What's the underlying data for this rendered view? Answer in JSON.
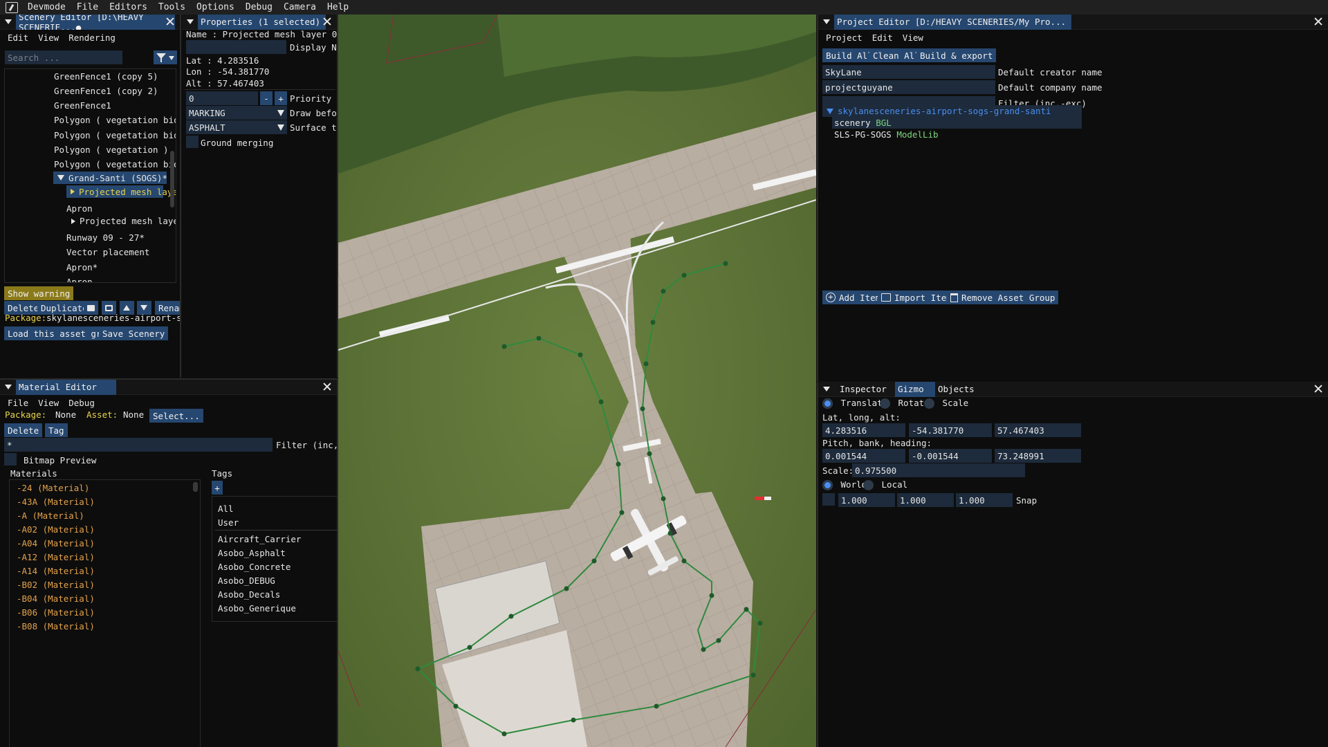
{
  "menubar": [
    "Devmode",
    "File",
    "Editors",
    "Tools",
    "Options",
    "Debug",
    "Camera",
    "Help"
  ],
  "scenery_editor": {
    "title": "Scenery Editor [D:\\HEAVY SCENERIE...●",
    "menu": [
      "Edit",
      "View",
      "Rendering"
    ],
    "search_placeholder": "Search ...",
    "tree": [
      "GreenFence1 (copy 5)",
      "GreenFence1 (copy 2)",
      "GreenFence1",
      "Polygon  ( vegetation biome",
      "Polygon  ( vegetation biome",
      "Polygon  ( vegetation )",
      "Polygon  ( vegetation biome",
      "Grand-Santi (SOGS)*",
      "Projected mesh layer",
      "Apron",
      "Projected mesh layer",
      "Runway 09 - 27*",
      "Vector placement",
      "Apron*",
      "Apron"
    ],
    "show_warning": "Show warning",
    "buttons": {
      "delete": "Delete",
      "duplicate": "Duplicate",
      "rename": "Renam"
    },
    "package_label": "Package:",
    "package_value": "skylanesceneries-airport-sogs-gr",
    "load_asset_group": "Load this asset group",
    "save_scenery": "Save Scenery"
  },
  "properties": {
    "title": "Properties (1 selected)",
    "name_line": "Name : Projected mesh layer 0",
    "display_name_label": "Display Nam",
    "lat": "Lat : 4.283516",
    "lon": "Lon : -54.381770",
    "alt": "Alt : 57.467403",
    "priority_value": "0",
    "priority_label": "Priority",
    "draw_before_value": "MARKING",
    "draw_before_label": "Draw before",
    "surface_value": "ASPHALT",
    "surface_label": "Surface typ",
    "ground_merging": "Ground merging",
    "minus": "-",
    "plus": "+"
  },
  "material_editor": {
    "title": "Material Editor",
    "menu": [
      "File",
      "View",
      "Debug"
    ],
    "package_label": "Package:",
    "package_value": "None",
    "asset_label": "Asset:",
    "asset_value": "None",
    "select_button": "Select...",
    "delete_button": "Delete",
    "tag_button": "Tag",
    "filter_value": "*",
    "filter_label": "Filter (inc,-exc)",
    "bitmap_preview": "Bitmap Preview",
    "materials_header": "Materials",
    "tags_header": "Tags",
    "add_tag": "+",
    "materials": [
      "-24 (Material)",
      "-43A (Material)",
      "-A (Material)",
      "-A02 (Material)",
      "-A04 (Material)",
      "-A12 (Material)",
      "-A14 (Material)",
      "-B02 (Material)",
      "-B04 (Material)",
      "-B06 (Material)",
      "-B08 (Material)"
    ],
    "tags_top": [
      "All",
      "User"
    ],
    "tags": [
      "Aircraft_Carrier",
      "Asobo_Asphalt",
      "Asobo_Concrete",
      "Asobo_DEBUG",
      "Asobo_Decals",
      "Asobo_Generique"
    ]
  },
  "project_editor": {
    "title": "Project Editor [D:/HEAVY SCENERIES/My Pro...",
    "menu": [
      "Project",
      "Edit",
      "View"
    ],
    "buttons": [
      "Build All",
      "Clean All",
      "Build & export"
    ],
    "creator_value": "SkyLane",
    "creator_label": "Default creator name",
    "company_value": "projectguyane",
    "company_label": "Default company name",
    "filter_label": "Filter (inc,-exc)",
    "tree_root": "skylanesceneries-airport-sogs-grand-santi",
    "tree_items": [
      {
        "name": "scenery",
        "tag": "BGL"
      },
      {
        "name": "SLS-PG-SOGS",
        "tag": "ModelLib"
      }
    ],
    "add_item": "Add Item",
    "import_item": "Import Item",
    "remove_asset_group": "Remove Asset Group"
  },
  "inspector": {
    "tabs": [
      "Inspector",
      "Gizmo",
      "Objects"
    ],
    "modes": [
      "Translate",
      "Rotate",
      "Scale"
    ],
    "lat_long_alt_label": "Lat, long, alt:",
    "lat_long_alt": [
      "4.283516",
      "-54.381770",
      "57.467403"
    ],
    "pbh_label": "Pitch, bank, heading:",
    "pbh": [
      "0.001544",
      "-0.001544",
      "73.248991"
    ],
    "scale_label": "Scale:",
    "scale_value": "0.975500",
    "space": [
      "World",
      "Local"
    ],
    "snap_values": [
      "1.000",
      "1.000",
      "1.000"
    ],
    "snap_label": "Snap"
  },
  "colors": {
    "accent": "#26476f",
    "field": "#1d2b3c",
    "highlight_text": "#e8d44d",
    "material_text": "#e4a24a",
    "tag_text": "#7ed67e",
    "grass": "#5e7436",
    "pavement": "#b7ab9f"
  }
}
